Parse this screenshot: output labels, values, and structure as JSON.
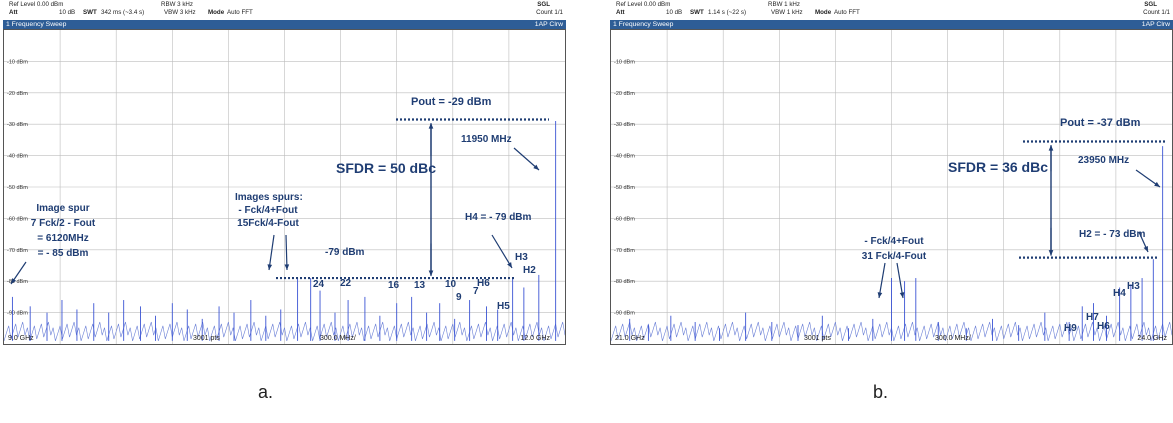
{
  "panels": [
    {
      "header": {
        "ref_level": "Ref Level 0.00 dBm",
        "att": "Att",
        "att_value": "10 dB",
        "swt": "SWT",
        "swt_value": "342 ms (~3.4 s)",
        "rbw": "RBW 3 kHz",
        "vbw": "VBW 3 kHz",
        "mode": "Mode",
        "mode_value": "Auto FFT",
        "sgl": "SGL",
        "count": "Count 1/1"
      },
      "title_bar": {
        "title": "1 Frequency Sweep",
        "trace": "1AP Clrw"
      },
      "footer": {
        "start": "9.0 GHz",
        "pts": "3001 pts",
        "span": "300.0 MHz/",
        "stop": "12.0 GHz"
      },
      "annotations": {
        "pout": "Pout  = -29 dBm",
        "carrier": "11950 MHz",
        "sfdr": "SFDR = 50 dBc",
        "image_spur_1": "Image spur",
        "image_spur_2": "7 Fck/2 - Fout",
        "image_spur_3": "= 6120MHz",
        "image_spur_4": "= - 85 dBm",
        "images_spurs_1": "Images spurs:",
        "images_spurs_2": "- Fck/4+Fout",
        "images_spurs_3": "15Fck/4-Fout",
        "h4": "H4 = - 79 dBm",
        "floor": "-79 dBm",
        "h3": "H3",
        "h2": "H2",
        "h6": "H6",
        "h5": "H5",
        "n24": "24",
        "n22": "22",
        "n16": "16",
        "n13": "13",
        "n10": "10",
        "n9": "9",
        "n7": "7"
      },
      "caption": "a."
    },
    {
      "header": {
        "ref_level": "Ref Level 0.00 dBm",
        "att": "Att",
        "att_value": "10 dB",
        "swt": "SWT",
        "swt_value": "1.14 s (~22 s)",
        "rbw": "RBW 1 kHz",
        "vbw": "VBW 1 kHz",
        "mode": "Mode",
        "mode_value": "Auto FFT",
        "sgl": "SGL",
        "count": "Count 1/1"
      },
      "title_bar": {
        "title": "1 Frequency Sweep",
        "trace": "1AP Clrw"
      },
      "footer": {
        "start": "21.0 GHz",
        "pts": "3001 pts",
        "span": "300.0 MHz/",
        "stop": "24.0 GHz"
      },
      "annotations": {
        "pout": "Pout  = -37 dBm",
        "carrier": "23950 MHz",
        "sfdr": "SFDR = 36 dBc",
        "images_spurs_2": "- Fck/4+Fout",
        "images_spurs_3": "31 Fck/4-Fout",
        "h2": "H2 = - 73 dBm",
        "h4": "H4",
        "h3": "H3",
        "h7": "H7",
        "h9": "H9",
        "h6": "H6"
      },
      "caption": "b."
    }
  ],
  "y_ticks": [
    "-10 dBm",
    "-20 dBm",
    "-30 dBm",
    "-40 dBm",
    "-50 dBm",
    "-60 dBm",
    "-70 dBm",
    "-80 dBm",
    "-90 dBm"
  ],
  "chart_data": [
    {
      "type": "spectrum",
      "x_start_ghz": 9.0,
      "x_stop_ghz": 12.0,
      "ylim": [
        -100,
        0
      ],
      "grid": true,
      "peaks": [
        {
          "x": 9.045,
          "y": -85
        },
        {
          "x": 9.14,
          "y": -88
        },
        {
          "x": 9.23,
          "y": -90
        },
        {
          "x": 9.31,
          "y": -86
        },
        {
          "x": 9.39,
          "y": -89
        },
        {
          "x": 9.48,
          "y": -87
        },
        {
          "x": 9.56,
          "y": -90
        },
        {
          "x": 9.64,
          "y": -86
        },
        {
          "x": 9.73,
          "y": -88
        },
        {
          "x": 9.81,
          "y": -91
        },
        {
          "x": 9.9,
          "y": -87
        },
        {
          "x": 9.98,
          "y": -89
        },
        {
          "x": 10.06,
          "y": -92
        },
        {
          "x": 10.15,
          "y": -88
        },
        {
          "x": 10.23,
          "y": -90
        },
        {
          "x": 10.32,
          "y": -86
        },
        {
          "x": 10.4,
          "y": -91
        },
        {
          "x": 10.48,
          "y": -89
        },
        {
          "x": 10.57,
          "y": -79
        },
        {
          "x": 10.64,
          "y": -79
        },
        {
          "x": 10.69,
          "y": -83
        },
        {
          "x": 10.77,
          "y": -90
        },
        {
          "x": 10.84,
          "y": -86
        },
        {
          "x": 10.93,
          "y": -85
        },
        {
          "x": 11.01,
          "y": -91
        },
        {
          "x": 11.1,
          "y": -87
        },
        {
          "x": 11.18,
          "y": -85
        },
        {
          "x": 11.26,
          "y": -90
        },
        {
          "x": 11.33,
          "y": -87
        },
        {
          "x": 11.41,
          "y": -92
        },
        {
          "x": 11.49,
          "y": -86
        },
        {
          "x": 11.58,
          "y": -88
        },
        {
          "x": 11.64,
          "y": -89
        },
        {
          "x": 11.72,
          "y": -79
        },
        {
          "x": 11.78,
          "y": -82
        },
        {
          "x": 11.86,
          "y": -78
        },
        {
          "x": 11.95,
          "y": -29
        }
      ]
    },
    {
      "type": "spectrum",
      "x_start_ghz": 21.0,
      "x_stop_ghz": 24.0,
      "ylim": [
        -100,
        0
      ],
      "grid": true,
      "peaks": [
        {
          "x": 21.1,
          "y": -92
        },
        {
          "x": 21.2,
          "y": -94
        },
        {
          "x": 21.32,
          "y": -91
        },
        {
          "x": 21.45,
          "y": -93
        },
        {
          "x": 21.58,
          "y": -95
        },
        {
          "x": 21.72,
          "y": -90
        },
        {
          "x": 21.86,
          "y": -93
        },
        {
          "x": 22.0,
          "y": -94
        },
        {
          "x": 22.13,
          "y": -91
        },
        {
          "x": 22.27,
          "y": -95
        },
        {
          "x": 22.4,
          "y": -92
        },
        {
          "x": 22.5,
          "y": -79
        },
        {
          "x": 22.57,
          "y": -80
        },
        {
          "x": 22.63,
          "y": -79
        },
        {
          "x": 22.75,
          "y": -93
        },
        {
          "x": 22.9,
          "y": -95
        },
        {
          "x": 23.04,
          "y": -92
        },
        {
          "x": 23.18,
          "y": -94
        },
        {
          "x": 23.32,
          "y": -90
        },
        {
          "x": 23.45,
          "y": -93
        },
        {
          "x": 23.52,
          "y": -88
        },
        {
          "x": 23.58,
          "y": -87
        },
        {
          "x": 23.65,
          "y": -91
        },
        {
          "x": 23.72,
          "y": -82
        },
        {
          "x": 23.78,
          "y": -81
        },
        {
          "x": 23.84,
          "y": -79
        },
        {
          "x": 23.9,
          "y": -73
        },
        {
          "x": 23.95,
          "y": -37
        }
      ]
    }
  ]
}
